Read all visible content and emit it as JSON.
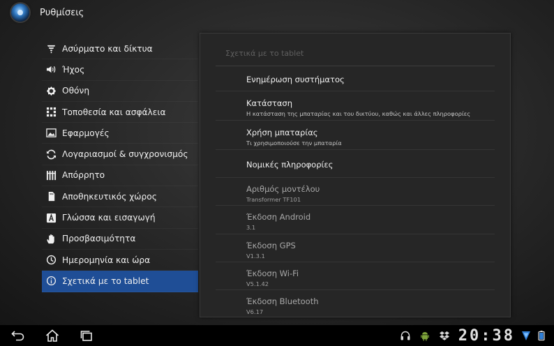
{
  "titlebar": {
    "title": "Ρυθμίσεις",
    "app_icon": "settings-app-icon"
  },
  "sidebar": {
    "items": [
      {
        "label": "Ασύρματο και δίκτυα",
        "icon": "wifi-icon"
      },
      {
        "label": "Ήχος",
        "icon": "sound-icon"
      },
      {
        "label": "Οθόνη",
        "icon": "display-icon"
      },
      {
        "label": "Τοποθεσία και ασφάλεια",
        "icon": "location-icon"
      },
      {
        "label": "Εφαρμογές",
        "icon": "apps-icon"
      },
      {
        "label": "Λογαριασμοί & συγχρονισμός",
        "icon": "sync-icon"
      },
      {
        "label": "Απόρρητο",
        "icon": "privacy-icon"
      },
      {
        "label": "Αποθηκευτικός χώρος",
        "icon": "storage-icon"
      },
      {
        "label": "Γλώσσα και εισαγωγή",
        "icon": "language-icon"
      },
      {
        "label": "Προσβασιμότητα",
        "icon": "accessibility-icon"
      },
      {
        "label": "Ημερομηνία και ώρα",
        "icon": "clock-icon"
      },
      {
        "label": "Σχετικά με το tablet",
        "icon": "info-icon",
        "selected": true
      }
    ]
  },
  "panel": {
    "header": "Σχετικά με το tablet",
    "rows": [
      {
        "title": "Ενημέρωση συστήματος",
        "summary": ""
      },
      {
        "title": "Κατάσταση",
        "summary": "Η κατάσταση της μπαταρίας και του δικτύου, καθώς και άλλες πληροφορίες"
      },
      {
        "title": "Χρήση μπαταρίας",
        "summary": "Τι χρησιμοποιούσε την μπαταρία"
      },
      {
        "title": "Νομικές πληροφορίες",
        "summary": ""
      },
      {
        "title": "Αριθμός μοντέλου",
        "summary": "Transformer TF101"
      },
      {
        "title": "Έκδοση Android",
        "summary": "3.1"
      },
      {
        "title": "Έκδοση GPS",
        "summary": "V1.3.1"
      },
      {
        "title": "Έκδοση Wi-Fi",
        "summary": "V5.1.42"
      },
      {
        "title": "Έκδοση Bluetooth",
        "summary": "V6.17"
      }
    ]
  },
  "navbar": {
    "buttons": [
      "back-icon",
      "home-icon",
      "recent-apps-icon"
    ],
    "status_icons": [
      "headphones-icon",
      "android-debug-icon",
      "dropbox-icon"
    ],
    "clock": "20:38",
    "accent": "#1f4e96"
  }
}
